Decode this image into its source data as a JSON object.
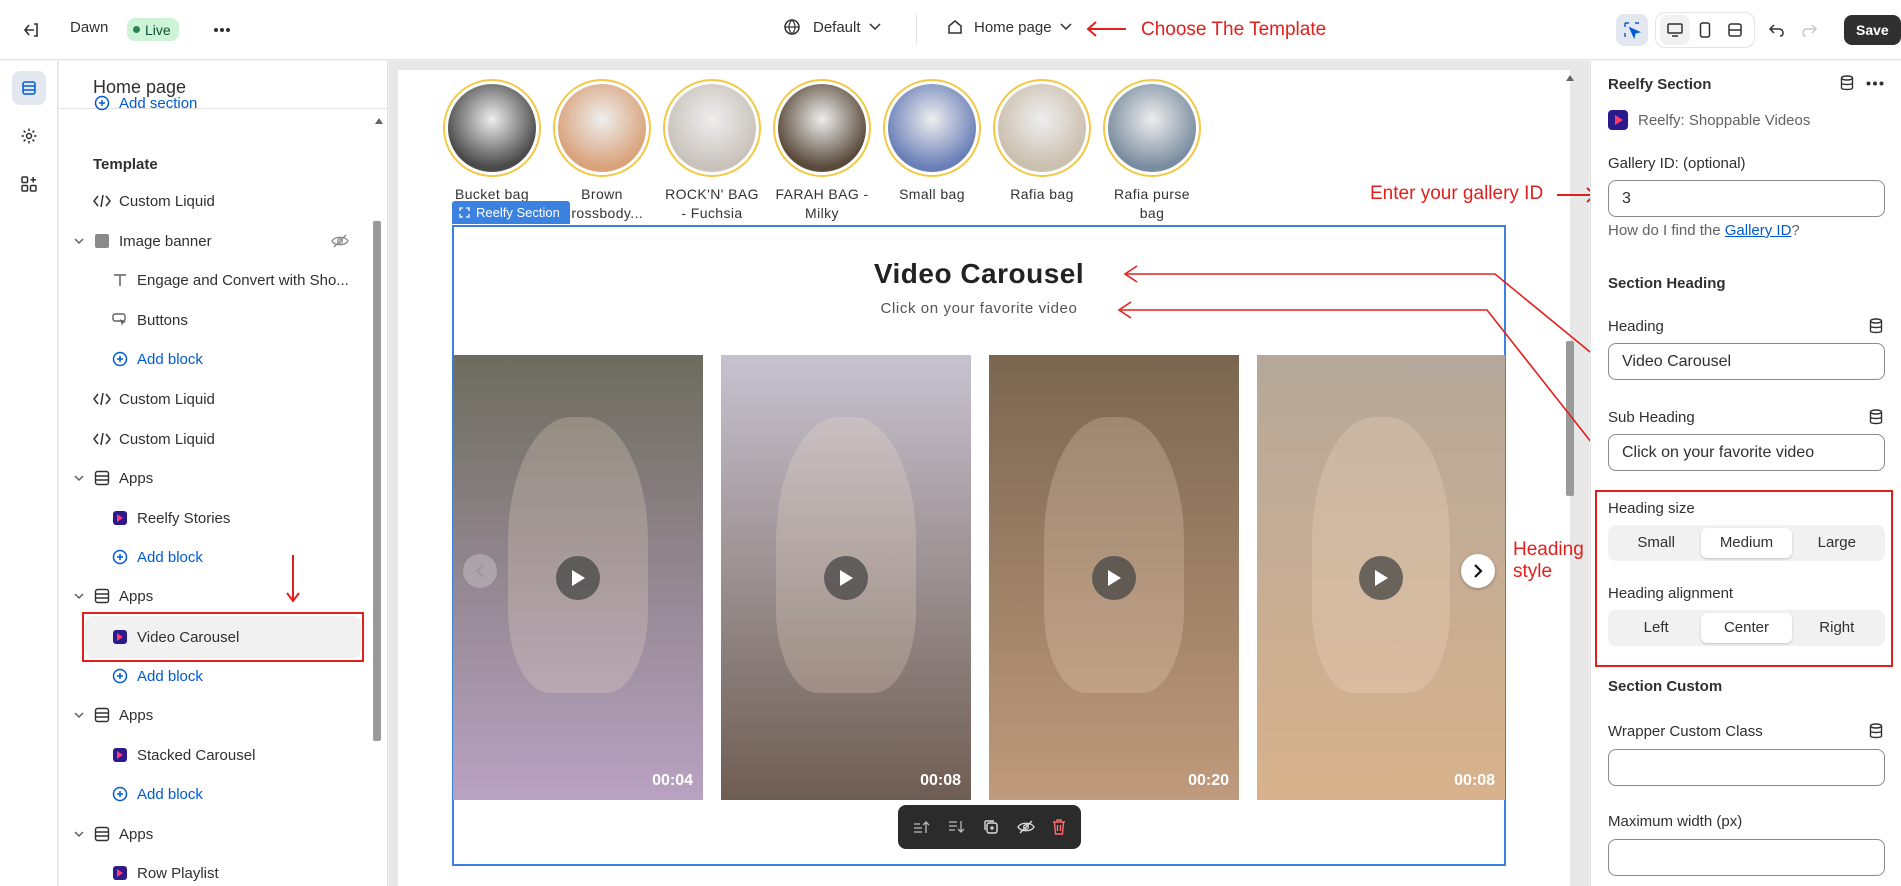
{
  "topbar": {
    "store_name": "Dawn",
    "live_badge": "Live",
    "theme_select": "Default",
    "template_select": "Home page",
    "save_label": "Save"
  },
  "annotations": {
    "choose_template": "Choose The Template",
    "enter_gallery": "Enter your gallery ID",
    "heading_style_1": "Heading",
    "heading_style_2": "style"
  },
  "left_panel": {
    "title": "Home page",
    "add_section": "Add section",
    "template_label": "Template",
    "items": [
      {
        "label": "Custom Liquid"
      },
      {
        "label": "Image banner"
      },
      {
        "label": "Engage and Convert with Sho..."
      },
      {
        "label": "Buttons"
      },
      {
        "label": "Add block"
      },
      {
        "label": "Custom Liquid"
      },
      {
        "label": "Custom Liquid"
      },
      {
        "label": "Apps"
      },
      {
        "label": "Reelfy Stories"
      },
      {
        "label": "Add block"
      },
      {
        "label": "Apps"
      },
      {
        "label": "Video Carousel"
      },
      {
        "label": "Add block"
      },
      {
        "label": "Apps"
      },
      {
        "label": "Stacked Carousel"
      },
      {
        "label": "Add block"
      },
      {
        "label": "Apps"
      },
      {
        "label": "Row Playlist"
      }
    ]
  },
  "preview": {
    "section_tag": "Reelfy Section",
    "stories": [
      {
        "label": "Bucket bag",
        "color": "#4a4a4a"
      },
      {
        "label": "Brown Crossbody...",
        "color": "#d9a27a"
      },
      {
        "label": "ROCK'N' BAG - Fuchsia",
        "color": "#c9c2bb"
      },
      {
        "label": "FARAH BAG - Milky",
        "color": "#5a4a3a"
      },
      {
        "label": "Small bag",
        "color": "#6a7fb8"
      },
      {
        "label": "Rafia bag",
        "color": "#cbbfae"
      },
      {
        "label": "Rafia purse bag",
        "color": "#7a8da0"
      }
    ],
    "heading": "Video Carousel",
    "subheading": "Click on your favorite video",
    "videos": [
      {
        "duration": "00:04",
        "color_top": "#6d6c5e",
        "color_bottom": "#b9a2c2"
      },
      {
        "duration": "00:08",
        "color_top": "#c7c2cf",
        "color_bottom": "#6e5d52"
      },
      {
        "duration": "00:20",
        "color_top": "#7a6650",
        "color_bottom": "#c09a7c"
      },
      {
        "duration": "00:08",
        "color_top": "#b5a89a",
        "color_bottom": "#d8b28c"
      }
    ]
  },
  "right_panel": {
    "section_title": "Reelfy Section",
    "app_name": "Reelfy: Shoppable Videos",
    "gallery_label": "Gallery ID: (optional)",
    "gallery_value": "3",
    "help_prefix": "How do I find the ",
    "help_link": "Gallery ID",
    "help_suffix": "?",
    "section_heading": "Section Heading",
    "heading_label": "Heading",
    "heading_value": "Video Carousel",
    "subheading_label": "Sub Heading",
    "subheading_value": "Click on your favorite video",
    "heading_size_label": "Heading size",
    "sizes": [
      "Small",
      "Medium",
      "Large"
    ],
    "heading_alignment_label": "Heading alignment",
    "alignments": [
      "Left",
      "Center",
      "Right"
    ],
    "section_custom": "Section Custom",
    "wrapper_label": "Wrapper Custom Class",
    "max_width_label": "Maximum width (px)"
  }
}
